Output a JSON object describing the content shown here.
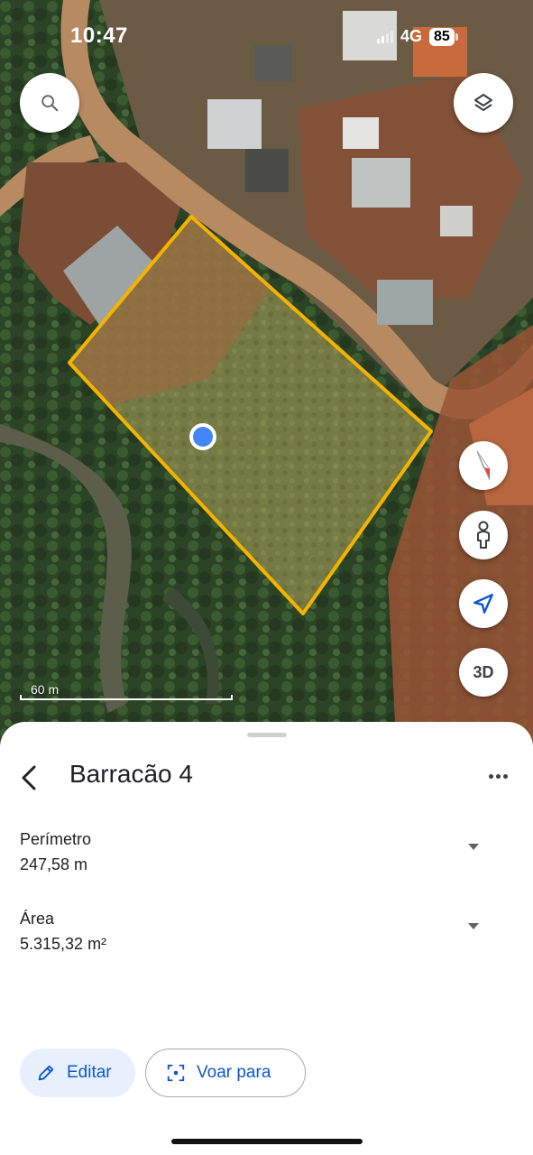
{
  "status_bar": {
    "time": "10:47",
    "network": "4G",
    "battery": "85"
  },
  "map": {
    "scale_label": "60 m",
    "polygon_color": "#f5b301",
    "location_dot_color": "#4285f4"
  },
  "controls": {
    "search_icon": "search-icon",
    "layers_icon": "layers-icon",
    "compass_icon": "compass-icon",
    "street_view_icon": "pegman-icon",
    "my_location_icon": "navigation-arrow-icon",
    "three_d_label": "3D"
  },
  "sheet": {
    "title": "Barracão 4",
    "metrics": [
      {
        "label": "Perímetro",
        "value": "247,58 m"
      },
      {
        "label": "Área",
        "value": "5.315,32 m²"
      }
    ],
    "actions": {
      "edit_label": "Editar",
      "fly_label": "Voar para"
    }
  },
  "colors": {
    "accent": "#0b57d0",
    "edit_bg": "#e8f0fe",
    "compass_red": "#ea4335"
  }
}
